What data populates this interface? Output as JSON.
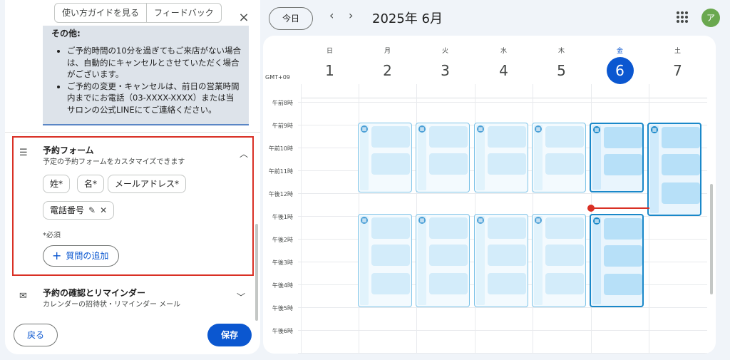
{
  "panel": {
    "guide_button": "使い方ガイドを見る",
    "feedback_button": "フィードバック",
    "close_icon": "×",
    "info": {
      "title": "その他:",
      "items": [
        "ご予約時間の10分を過ぎてもご来店がない場合は、自動的にキャンセルとさせていただく場合がございます。",
        "ご予約の変更・キャンセルは、前日の営業時間内までにお電話（03-XXXX-XXXX）または当サロンの公式LINEにてご連絡ください。"
      ]
    },
    "form_section": {
      "icon": "list-icon",
      "title": "予約フォーム",
      "subtitle": "予定の予約フォームをカスタマイズできます",
      "fields": [
        "姓*",
        "名*",
        "メールアドレス*"
      ],
      "phone_field": "電話番号",
      "required_note": "*必須",
      "add_question": "質問の追加"
    },
    "confirm_section": {
      "icon": "mail-icon",
      "title": "予約の確認とリマインダー",
      "subtitle": "カレンダーの招待状・リマインダー メール"
    },
    "back_button": "戻る",
    "save_button": "保存"
  },
  "header": {
    "today_button": "今日",
    "month_title": "2025年 6月",
    "avatar_letter": "ア"
  },
  "calendar": {
    "timezone": "GMT+09",
    "days": [
      {
        "dow": "日",
        "num": "1"
      },
      {
        "dow": "月",
        "num": "2"
      },
      {
        "dow": "火",
        "num": "3"
      },
      {
        "dow": "水",
        "num": "4"
      },
      {
        "dow": "木",
        "num": "5"
      },
      {
        "dow": "金",
        "num": "6",
        "today": true
      },
      {
        "dow": "土",
        "num": "7"
      }
    ],
    "time_labels": [
      "午前8時",
      "午前9時",
      "午前10時",
      "午前11時",
      "午後12時",
      "午後1時",
      "午後2時",
      "午後3時",
      "午後4時",
      "午後5時",
      "午後6時"
    ]
  }
}
